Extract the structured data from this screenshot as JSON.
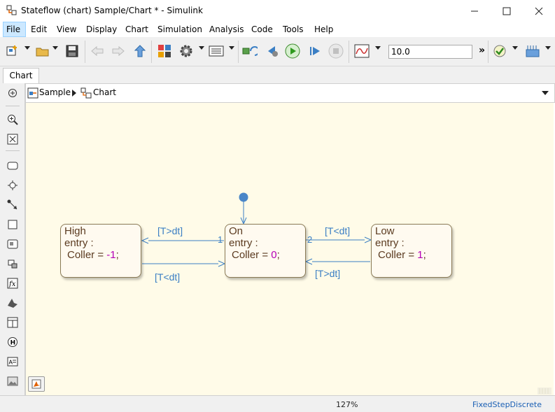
{
  "window": {
    "title": "Stateflow (chart) Sample/Chart * - Simulink",
    "controls": [
      "minimize",
      "maximize",
      "close"
    ]
  },
  "menu": {
    "items": [
      "File",
      "Edit",
      "View",
      "Display",
      "Chart",
      "Simulation",
      "Analysis",
      "Code",
      "Tools",
      "Help"
    ],
    "active": "File"
  },
  "toolbar": {
    "stop_time": "10.0",
    "overflow": "»"
  },
  "tabs": [
    {
      "label": "Chart",
      "active": true
    }
  ],
  "breadcrumb": {
    "items": [
      "Sample",
      "Chart"
    ]
  },
  "chart": {
    "states": [
      {
        "name": "High",
        "entry": "entry :",
        "action_prefix": "Coller = ",
        "value": "-1",
        "action_suffix": ";"
      },
      {
        "name": "On",
        "entry": "entry :",
        "action_prefix": "Coller = ",
        "value": "0",
        "action_suffix": ";"
      },
      {
        "name": "Low",
        "entry": "entry :",
        "action_prefix": "Coller = ",
        "value": "1",
        "action_suffix": ";"
      }
    ],
    "transitions": [
      {
        "label": "[T>dt]",
        "order": "1"
      },
      {
        "label": "[T<dt]"
      },
      {
        "label": "[T<dt]",
        "order": "2"
      },
      {
        "label": "[T>dt]"
      }
    ]
  },
  "status": {
    "zoom": "127%",
    "solver": "FixedStepDiscrete"
  },
  "colors": {
    "canvas": "#fffbe8",
    "transition": "#3b7fc4",
    "state_border": "#8a7a56",
    "number": "#b500b5",
    "solver_link": "#1a5fb4"
  }
}
